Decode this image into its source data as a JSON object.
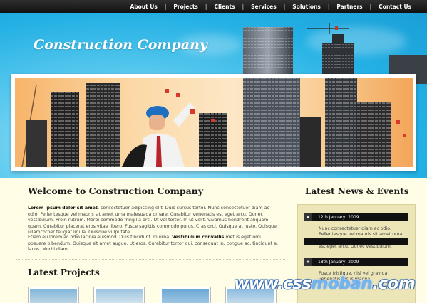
{
  "nav": {
    "items": [
      "About Us",
      "Projects",
      "Clients",
      "Services",
      "Solutions",
      "Partners",
      "Contact Us"
    ],
    "separator": "|"
  },
  "header": {
    "site_title": "Construction Company"
  },
  "main": {
    "welcome_title": "Welcome to Construction Company",
    "para1": {
      "lead": "Lorem ipsum dolor sit amet",
      "text": ", consectetuer adipiscing elit. Duis cursus tortor. Nunc consectetuer diam ac odio. Pellentesque vel mauris sit amet urna malesuada ornare. Curabitur venenatis est eget arcu. Donec vestibulum. Proin rutrum. Morbi commodo fringilla orci. Ut vel tortor. In ut velit. Vivamus hendrerit aliquam quam. Curabitur placerat eros vitae libero. Fusce sagittis commodo purus. Cras orci. Quisque at justo. Quisque ullamcorper feugiat ligula. Quisque vulputate."
    },
    "para2": {
      "before": "Etiam eu lorem ac odio lacinia euismod. Duis tincidunt. In urna. ",
      "bold": "Vestibulum convallis",
      "after": " metus eget orci posuere bibendum. Quisque sit amet augue. Ut eros. Curabitur tortor dui, consequat in, congue ac, tincidunt a, lacus. Morbi diam."
    },
    "projects_title": "Latest Projects"
  },
  "sidebar": {
    "title": "Latest News & Events",
    "news": [
      {
        "date": "12th January, 2009",
        "text": "Nunc consectetuer diam ac odio. Pellentesque vel mauris sit amet urna malesuada ornare. Curabitur venenatis est eget arcu. Donec vestibulum."
      },
      {
        "date": "18th January, 2009",
        "text": "Fusce tristique, nisl vel gravida venenatis, risus magna"
      }
    ]
  },
  "watermark": {
    "part1": "www.css",
    "part2": "moban",
    "part3": ".com"
  },
  "colors": {
    "accent": "#23b0e4",
    "background": "#fffde6",
    "sidebar": "#ebe5b8"
  }
}
